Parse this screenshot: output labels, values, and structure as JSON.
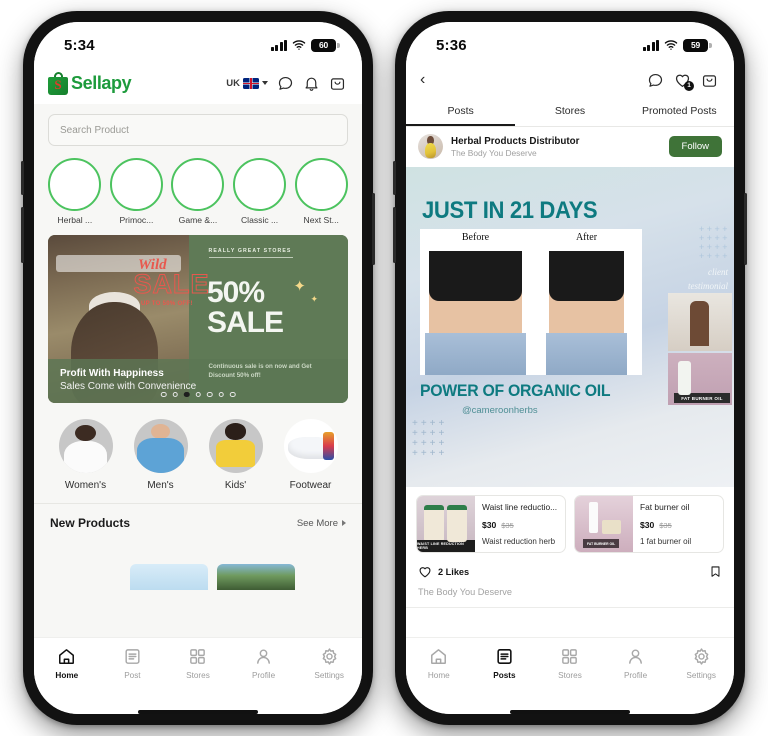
{
  "left_phone": {
    "status_bar": {
      "time": "5:34",
      "battery": "60",
      "wifi_icon": "wifi-icon",
      "signal_icon": "cellular-signal-icon"
    },
    "header": {
      "brand": "Sellapy",
      "brand_mark": "S",
      "locale": "UK",
      "flag_icon": "uk-flag-icon",
      "dropdown_icon": "chevron-down-icon",
      "chat_icon": "chat-bubble-icon",
      "bell_icon": "notification-bell-icon",
      "bag_icon": "shopping-bag-icon"
    },
    "search": {
      "placeholder": "Search Product"
    },
    "stories": [
      {
        "label": "Herbal ..."
      },
      {
        "label": "Primoc..."
      },
      {
        "label": "Game &..."
      },
      {
        "label": "Classic ..."
      },
      {
        "label": "Next St..."
      }
    ],
    "banner": {
      "wild": "Wild",
      "sale_script": "SALE",
      "up_to": "UP TO 50% OFF!",
      "kicker": "REALLY GREAT STORES",
      "percent": "50%",
      "sale": "SALE",
      "title": "Profit With Happiness",
      "subtitle": "Sales Come with Convenience",
      "description": "Continuous sale is on now and Get Discount 50% off!",
      "dot_count": 7,
      "active_dot": 3
    },
    "categories": [
      {
        "label": "Women's"
      },
      {
        "label": "Men's"
      },
      {
        "label": "Kids'"
      },
      {
        "label": "Footwear"
      }
    ],
    "new_products": {
      "title": "New Products",
      "see_more": "See More",
      "chevron_icon": "chevron-right-icon"
    },
    "tabs": [
      {
        "label": "Home",
        "icon": "home-icon",
        "active": true
      },
      {
        "label": "Post",
        "icon": "post-icon",
        "active": false
      },
      {
        "label": "Stores",
        "icon": "grid-stores-icon",
        "active": false
      },
      {
        "label": "Profile",
        "icon": "person-icon",
        "active": false
      },
      {
        "label": "Settings",
        "icon": "gear-icon",
        "active": false
      }
    ]
  },
  "right_phone": {
    "status_bar": {
      "time": "5:36",
      "battery": "59",
      "wifi_icon": "wifi-icon",
      "signal_icon": "cellular-signal-icon"
    },
    "header": {
      "back_icon": "back-chevron-icon",
      "chat_icon": "chat-bubble-icon",
      "heart_icon": "heart-icon",
      "heart_badge": "1",
      "bag_icon": "shopping-bag-icon"
    },
    "tabs": [
      {
        "label": "Posts",
        "active": true
      },
      {
        "label": "Stores",
        "active": false
      },
      {
        "label": "Promoted Posts",
        "active": false
      }
    ],
    "post": {
      "author": "Herbal Products Distributor",
      "author_subtitle": "The Body You Deserve",
      "follow_label": "Follow",
      "avatar_icon": "avatar",
      "image": {
        "headline": "JUST IN 21 DAYS",
        "before_label": "Before",
        "after_label": "After",
        "subheadline": "POWER OF ORGANIC OIL",
        "handle": "@cameroonherbs",
        "side_script_line1": "client",
        "side_script_line2": "testimonial",
        "side_caption": "FAT BURNER OIL"
      },
      "products": [
        {
          "name": "Waist line reductio...",
          "price": "$30",
          "old_price": "$35",
          "desc": "Waist reduction herb",
          "thumb_label": "WAIST LINE REDUCTION HERB"
        },
        {
          "name": "Fat burner oil",
          "price": "$30",
          "old_price": "$35",
          "desc": "1 fat burner oil",
          "thumb_label": "FAT BURNER OIL"
        }
      ],
      "likes": "2 Likes",
      "like_icon": "heart-outline-icon",
      "bookmark_icon": "bookmark-icon",
      "caption": "The Body You Deserve"
    },
    "tabs_bottom": [
      {
        "label": "Home",
        "icon": "home-icon",
        "active": false
      },
      {
        "label": "Posts",
        "icon": "post-icon",
        "active": true
      },
      {
        "label": "Stores",
        "icon": "grid-stores-icon",
        "active": false
      },
      {
        "label": "Profile",
        "icon": "person-icon",
        "active": false
      },
      {
        "label": "Settings",
        "icon": "gear-icon",
        "active": false
      }
    ]
  },
  "colors": {
    "brand_green": "#1d9b3c",
    "story_ring": "#4cc35f",
    "follow_green": "#3f7338",
    "teal": "#0e7a80",
    "banner_green": "#5f7a56",
    "sale_red": "#e8584e"
  }
}
